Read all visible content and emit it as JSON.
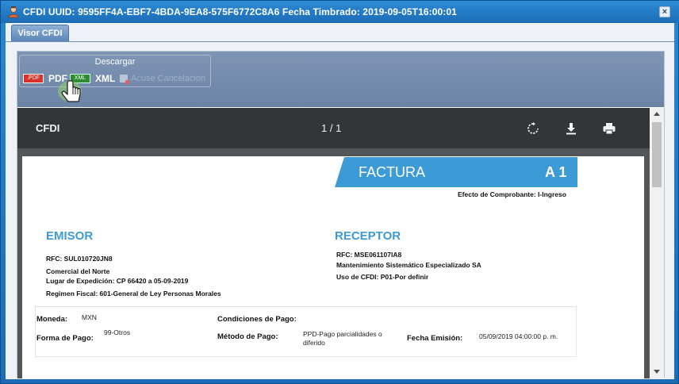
{
  "window": {
    "title": "CFDI UUID: 9595FF4A-EBF7-4BDA-9EA8-575F6772C8A6 Fecha Timbrado: 2019-09-05T16:00:01",
    "close_label": "×"
  },
  "tabs": [
    {
      "label": "Visor CFDI"
    }
  ],
  "toolbar": {
    "group_title": "Descargar",
    "pdf_badge": ".PDF",
    "pdf_label": "PDF",
    "xml_badge": "XML",
    "xml_label": "XML",
    "acuse_label": "Acuse Cancelacion"
  },
  "viewer": {
    "title": "CFDI",
    "page_indicator": "1 / 1",
    "icons": [
      "rotate-icon",
      "download-icon",
      "print-icon"
    ]
  },
  "document": {
    "doc_type": "FACTURA",
    "serie_folio": "A 1",
    "efecto": "Efecto de Comprobante: I-Ingreso",
    "emisor": {
      "heading": "EMISOR",
      "rfc": "RFC: SUL010720JN8",
      "nombre": "Comercial del Norte",
      "lugar": "Lugar de Expedición: CP 66420 a 05-09-2019",
      "regimen": "Regimen Fiscal: 601-General de Ley Personas Morales"
    },
    "receptor": {
      "heading": "RECEPTOR",
      "rfc": "RFC: MSE061107IA8",
      "nombre": "Mantenimiento Sistemático Especializado SA",
      "uso": "Uso de CFDI: P01-Por definir"
    },
    "details": {
      "moneda_label": "Moneda:",
      "moneda_value": "MXN",
      "forma_label": "Forma de Pago:",
      "forma_value": "99-Otros",
      "condiciones_label": "Condiciones de Pago:",
      "metodo_label": "Método de Pago:",
      "metodo_value_line1": "PPD-Pago parcialidades o",
      "metodo_value_line2": "diferido",
      "fecha_label": "Fecha Emisión:",
      "fecha_value": "05/09/2019 04:00:00 p. m."
    }
  },
  "colors": {
    "titlebar": "#1b6cb5",
    "ribbon": "#6b83a6",
    "viewer_bar": "#323639",
    "banner": "#3c9ad6",
    "heading": "#3c9ad6"
  }
}
